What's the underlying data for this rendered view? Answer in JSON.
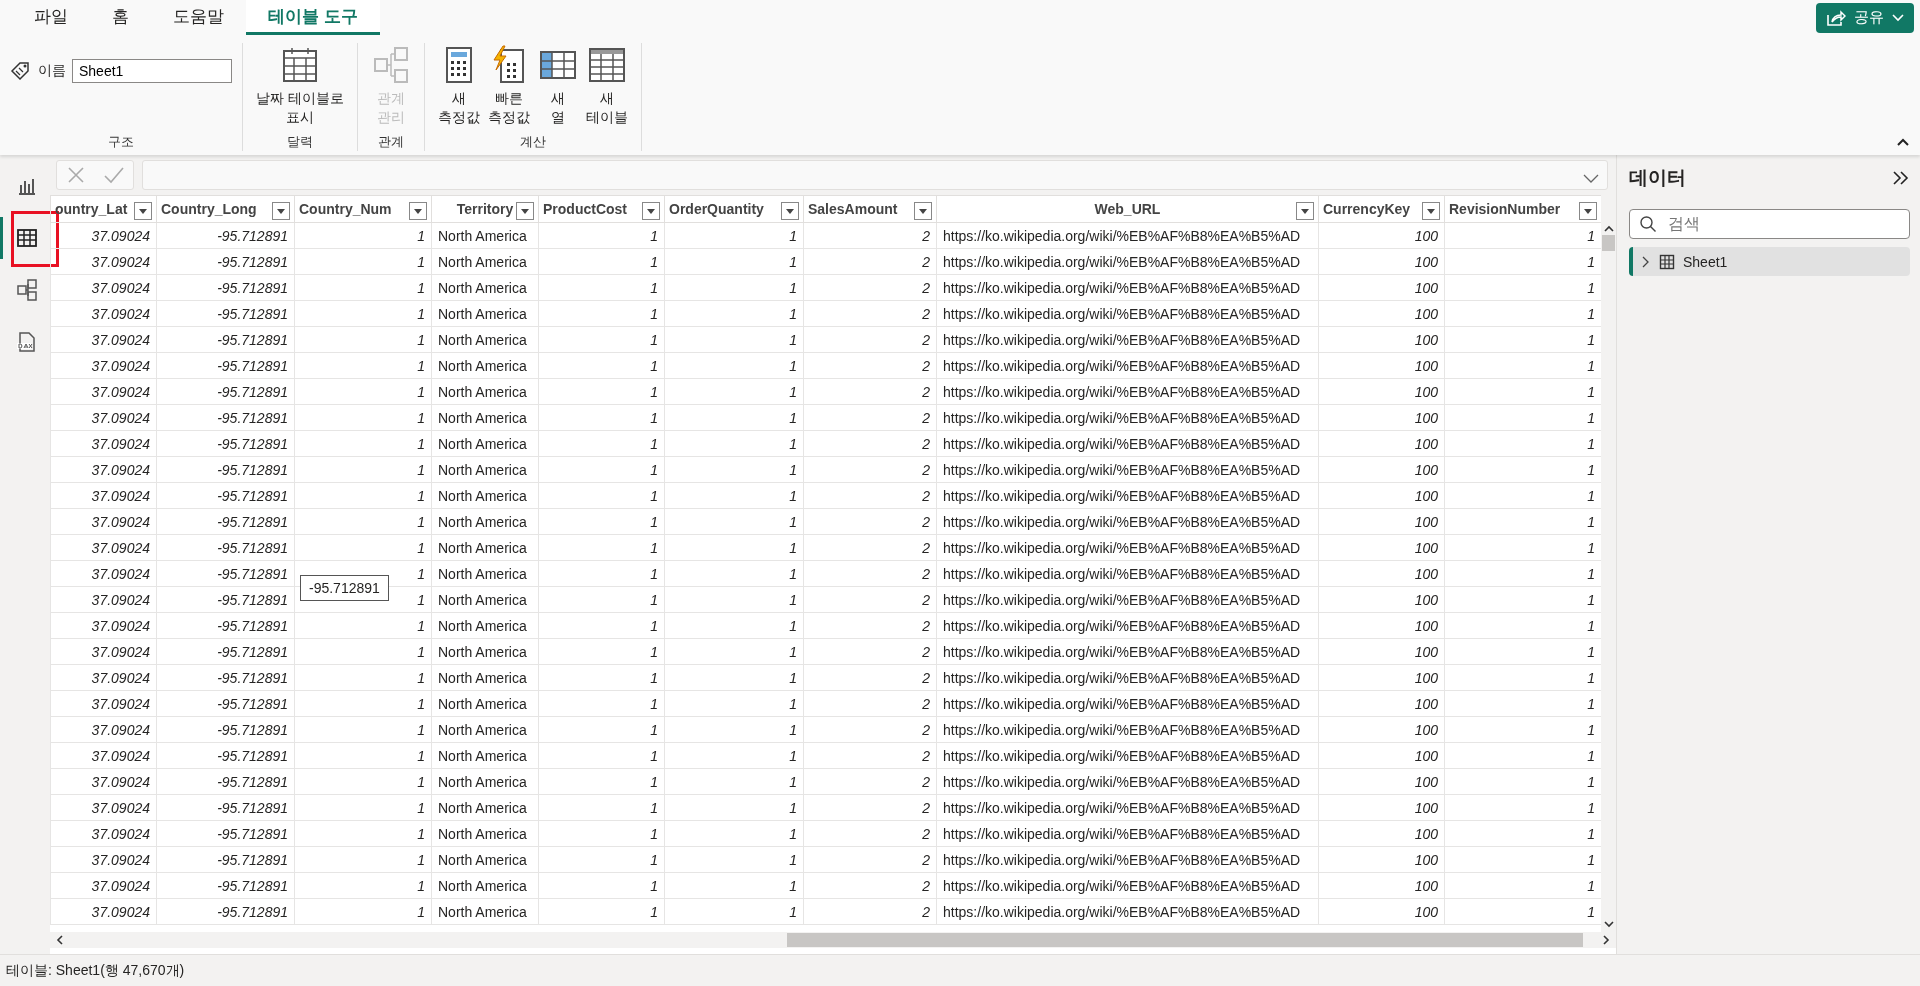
{
  "ribbon": {
    "tabs": [
      {
        "label": "파일",
        "selected": false
      },
      {
        "label": "홈",
        "selected": false
      },
      {
        "label": "도움말",
        "selected": false
      },
      {
        "label": "테이블 도구",
        "selected": true
      }
    ],
    "share_button": "공유",
    "groups": [
      {
        "label": "구조",
        "kind": "name",
        "name_label": "이름",
        "name_value": "Sheet1"
      },
      {
        "label": "달력",
        "kind": "buttons",
        "buttons": [
          {
            "lines": [
              "날짜 테이블로",
              "표시"
            ],
            "kind": "calendar",
            "disabled": false
          }
        ]
      },
      {
        "label": "관계",
        "kind": "buttons",
        "buttons": [
          {
            "lines": [
              "관계",
              "관리"
            ],
            "kind": "relations",
            "disabled": true
          }
        ]
      },
      {
        "label": "계산",
        "kind": "buttons",
        "buttons": [
          {
            "lines": [
              "새",
              "측정값"
            ],
            "kind": "calculator",
            "disabled": false
          },
          {
            "lines": [
              "빠른",
              "측정값"
            ],
            "kind": "quick",
            "disabled": false
          },
          {
            "lines": [
              "새",
              "열"
            ],
            "kind": "column",
            "disabled": false
          },
          {
            "lines": [
              "새",
              "테이블"
            ],
            "kind": "table",
            "disabled": false
          }
        ]
      }
    ]
  },
  "nav": [
    {
      "kind": "report",
      "selected": false,
      "highlighted": false
    },
    {
      "kind": "table",
      "selected": true,
      "highlighted": true
    },
    {
      "kind": "model",
      "selected": false,
      "highlighted": false
    },
    {
      "kind": "dax",
      "selected": false,
      "highlighted": false
    }
  ],
  "table": {
    "columns": [
      {
        "name": "ountry_Lat",
        "kind": "number"
      },
      {
        "name": "Country_Long",
        "kind": "number"
      },
      {
        "name": "Country_Num",
        "kind": "number"
      },
      {
        "name": "Territory",
        "kind": "text"
      },
      {
        "name": "ProductCost",
        "kind": "number"
      },
      {
        "name": "OrderQuantity",
        "kind": "number"
      },
      {
        "name": "SalesAmount",
        "kind": "number"
      },
      {
        "name": "Web_URL",
        "kind": "text"
      },
      {
        "name": "CurrencyKey",
        "kind": "number"
      },
      {
        "name": "RevisionNumber",
        "kind": "number"
      }
    ],
    "rows": [
      [
        "37.09024",
        "-95.712891",
        "1",
        "North America",
        "1",
        "1",
        "2",
        "https://ko.wikipedia.org/wiki/%EB%AF%B8%EA%B5%AD",
        "100",
        "1"
      ],
      [
        "37.09024",
        "-95.712891",
        "1",
        "North America",
        "1",
        "1",
        "2",
        "https://ko.wikipedia.org/wiki/%EB%AF%B8%EA%B5%AD",
        "100",
        "1"
      ],
      [
        "37.09024",
        "-95.712891",
        "1",
        "North America",
        "1",
        "1",
        "2",
        "https://ko.wikipedia.org/wiki/%EB%AF%B8%EA%B5%AD",
        "100",
        "1"
      ],
      [
        "37.09024",
        "-95.712891",
        "1",
        "North America",
        "1",
        "1",
        "2",
        "https://ko.wikipedia.org/wiki/%EB%AF%B8%EA%B5%AD",
        "100",
        "1"
      ],
      [
        "37.09024",
        "-95.712891",
        "1",
        "North America",
        "1",
        "1",
        "2",
        "https://ko.wikipedia.org/wiki/%EB%AF%B8%EA%B5%AD",
        "100",
        "1"
      ],
      [
        "37.09024",
        "-95.712891",
        "1",
        "North America",
        "1",
        "1",
        "2",
        "https://ko.wikipedia.org/wiki/%EB%AF%B8%EA%B5%AD",
        "100",
        "1"
      ],
      [
        "37.09024",
        "-95.712891",
        "1",
        "North America",
        "1",
        "1",
        "2",
        "https://ko.wikipedia.org/wiki/%EB%AF%B8%EA%B5%AD",
        "100",
        "1"
      ],
      [
        "37.09024",
        "-95.712891",
        "1",
        "North America",
        "1",
        "1",
        "2",
        "https://ko.wikipedia.org/wiki/%EB%AF%B8%EA%B5%AD",
        "100",
        "1"
      ],
      [
        "37.09024",
        "-95.712891",
        "1",
        "North America",
        "1",
        "1",
        "2",
        "https://ko.wikipedia.org/wiki/%EB%AF%B8%EA%B5%AD",
        "100",
        "1"
      ],
      [
        "37.09024",
        "-95.712891",
        "1",
        "North America",
        "1",
        "1",
        "2",
        "https://ko.wikipedia.org/wiki/%EB%AF%B8%EA%B5%AD",
        "100",
        "1"
      ],
      [
        "37.09024",
        "-95.712891",
        "1",
        "North America",
        "1",
        "1",
        "2",
        "https://ko.wikipedia.org/wiki/%EB%AF%B8%EA%B5%AD",
        "100",
        "1"
      ],
      [
        "37.09024",
        "-95.712891",
        "1",
        "North America",
        "1",
        "1",
        "2",
        "https://ko.wikipedia.org/wiki/%EB%AF%B8%EA%B5%AD",
        "100",
        "1"
      ],
      [
        "37.09024",
        "-95.712891",
        "1",
        "North America",
        "1",
        "1",
        "2",
        "https://ko.wikipedia.org/wiki/%EB%AF%B8%EA%B5%AD",
        "100",
        "1"
      ],
      [
        "37.09024",
        "-95.712891",
        "1",
        "North America",
        "1",
        "1",
        "2",
        "https://ko.wikipedia.org/wiki/%EB%AF%B8%EA%B5%AD",
        "100",
        "1"
      ],
      [
        "37.09024",
        "-95.712891",
        "1",
        "North America",
        "1",
        "1",
        "2",
        "https://ko.wikipedia.org/wiki/%EB%AF%B8%EA%B5%AD",
        "100",
        "1"
      ],
      [
        "37.09024",
        "-95.712891",
        "1",
        "North America",
        "1",
        "1",
        "2",
        "https://ko.wikipedia.org/wiki/%EB%AF%B8%EA%B5%AD",
        "100",
        "1"
      ],
      [
        "37.09024",
        "-95.712891",
        "1",
        "North America",
        "1",
        "1",
        "2",
        "https://ko.wikipedia.org/wiki/%EB%AF%B8%EA%B5%AD",
        "100",
        "1"
      ],
      [
        "37.09024",
        "-95.712891",
        "1",
        "North America",
        "1",
        "1",
        "2",
        "https://ko.wikipedia.org/wiki/%EB%AF%B8%EA%B5%AD",
        "100",
        "1"
      ],
      [
        "37.09024",
        "-95.712891",
        "1",
        "North America",
        "1",
        "1",
        "2",
        "https://ko.wikipedia.org/wiki/%EB%AF%B8%EA%B5%AD",
        "100",
        "1"
      ],
      [
        "37.09024",
        "-95.712891",
        "1",
        "North America",
        "1",
        "1",
        "2",
        "https://ko.wikipedia.org/wiki/%EB%AF%B8%EA%B5%AD",
        "100",
        "1"
      ],
      [
        "37.09024",
        "-95.712891",
        "1",
        "North America",
        "1",
        "1",
        "2",
        "https://ko.wikipedia.org/wiki/%EB%AF%B8%EA%B5%AD",
        "100",
        "1"
      ],
      [
        "37.09024",
        "-95.712891",
        "1",
        "North America",
        "1",
        "1",
        "2",
        "https://ko.wikipedia.org/wiki/%EB%AF%B8%EA%B5%AD",
        "100",
        "1"
      ],
      [
        "37.09024",
        "-95.712891",
        "1",
        "North America",
        "1",
        "1",
        "2",
        "https://ko.wikipedia.org/wiki/%EB%AF%B8%EA%B5%AD",
        "100",
        "1"
      ],
      [
        "37.09024",
        "-95.712891",
        "1",
        "North America",
        "1",
        "1",
        "2",
        "https://ko.wikipedia.org/wiki/%EB%AF%B8%EA%B5%AD",
        "100",
        "1"
      ],
      [
        "37.09024",
        "-95.712891",
        "1",
        "North America",
        "1",
        "1",
        "2",
        "https://ko.wikipedia.org/wiki/%EB%AF%B8%EA%B5%AD",
        "100",
        "1"
      ],
      [
        "37.09024",
        "-95.712891",
        "1",
        "North America",
        "1",
        "1",
        "2",
        "https://ko.wikipedia.org/wiki/%EB%AF%B8%EA%B5%AD",
        "100",
        "1"
      ],
      [
        "37.09024",
        "-95.712891",
        "1",
        "North America",
        "1",
        "1",
        "2",
        "https://ko.wikipedia.org/wiki/%EB%AF%B8%EA%B5%AD",
        "100",
        "1"
      ]
    ],
    "tooltip": "-95.712891"
  },
  "data_pane": {
    "title": "데이터",
    "search": {
      "placeholder": "검색"
    },
    "items": [
      {
        "label": "Sheet1",
        "selected": true,
        "expanded": false
      }
    ]
  },
  "status_bar": "테이블: Sheet1(행 47,670개)"
}
